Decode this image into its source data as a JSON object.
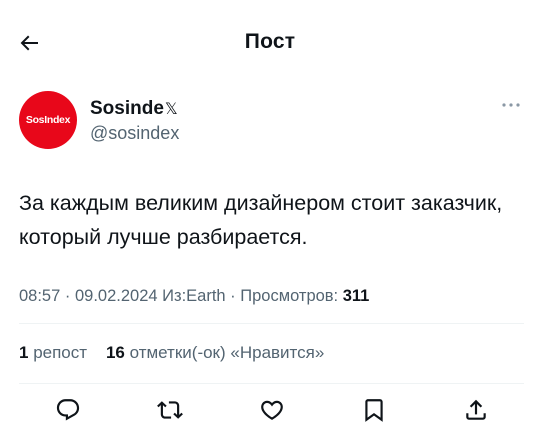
{
  "header": {
    "title": "Пост",
    "back_icon": "arrow-left-icon"
  },
  "author": {
    "avatar_text": "SosIndex",
    "avatar_color": "#e8071a",
    "display_name": "Sosinde",
    "display_name_suffix": "𝕏",
    "handle": "@sosindex"
  },
  "tweet": {
    "text": "За каждым великим дизайнером стоит заказчик, который лучше разбирается."
  },
  "meta": {
    "time": "08:57",
    "sep1": " · ",
    "date": "09.02.2024",
    "source_prefix": " Из:",
    "source": "Earth",
    "sep2": " · ",
    "views_label": "Просмотров: ",
    "views": "311"
  },
  "stats": {
    "reposts_count": "1",
    "reposts_label": " репост",
    "likes_count": "16",
    "likes_label": " отметки(-ок) «Нравится»"
  },
  "actions": [
    {
      "name": "reply",
      "icon": "comment-icon"
    },
    {
      "name": "repost",
      "icon": "repost-icon"
    },
    {
      "name": "like",
      "icon": "heart-icon"
    },
    {
      "name": "bookmark",
      "icon": "bookmark-icon"
    },
    {
      "name": "share",
      "icon": "share-icon"
    }
  ],
  "colors": {
    "text_primary": "#0f1419",
    "text_secondary": "#536471",
    "divider": "#eff3f4",
    "brand_red": "#e8071a"
  }
}
